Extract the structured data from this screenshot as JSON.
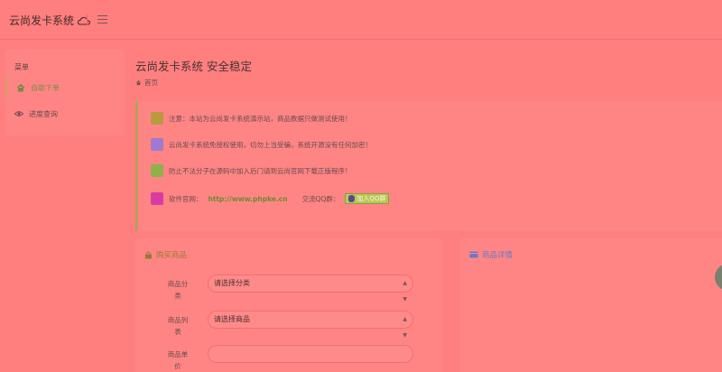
{
  "header": {
    "brand": "云尚发卡系统",
    "brand_icon": "cloud-icon",
    "menu_icon": "hamburger-icon"
  },
  "sidebar": {
    "heading": "菜单",
    "items": [
      {
        "label": "自助下单",
        "icon": "home-icon",
        "active": true
      },
      {
        "label": "进度查询",
        "icon": "eye-icon",
        "active": false
      }
    ]
  },
  "main": {
    "title": "云尚发卡系统 安全稳定",
    "breadcrumb": "首页"
  },
  "notices": [
    {
      "text": "注意：本站为云尚发卡系统演示站，商品数据只做测试使用！"
    },
    {
      "text": "云尚发卡系统免授权使用，切勿上当受骗，系统开源没有任何加密！"
    },
    {
      "text": "防止不法分子在源码中加入后门请到云尚官网下载正版程序！"
    },
    {
      "prefix": "软件官网：",
      "link": "http://www.phpke.cn",
      "qq_label": "交流QQ群：",
      "qq_button": "加入QQ群"
    }
  ],
  "buy_card": {
    "title": "购买商品",
    "fields": [
      {
        "label_line1": "商品分",
        "label_line2": "类",
        "value": "请选择分类"
      },
      {
        "label_line1": "商品列",
        "label_line2": "表",
        "value": "请选择商品"
      },
      {
        "label_line1": "商品单",
        "label_line2": "价",
        "value": ""
      }
    ]
  },
  "detail_card": {
    "title": "商品详情"
  },
  "colors": {
    "background": "#ff7f7f",
    "panel": "#ff8585",
    "accent_green": "#6e8a30",
    "accent_blue": "#6a78c8"
  }
}
